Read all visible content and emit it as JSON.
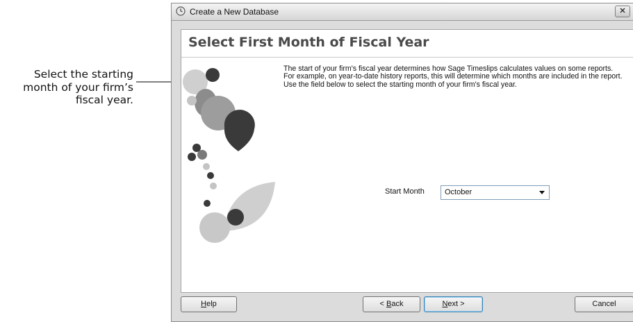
{
  "annotation": {
    "lines": [
      "Select the starting",
      "month of your firm’s",
      "fiscal year."
    ]
  },
  "window": {
    "title": "Create a New Database",
    "close_glyph": "✕"
  },
  "page": {
    "title": "Select First Month of Fiscal Year",
    "description": "The start of your firm's fiscal year determines how Sage Timeslips calculates values on some reports. For example, on year-to-date history reports, this will determine which months are included in the report. Use the field below to select the starting month of your firm's fiscal year.",
    "start_month_label": "Start Month",
    "start_month_value": "October"
  },
  "buttons": {
    "help": {
      "accel": "H",
      "rest": "elp"
    },
    "back": {
      "prefix": "< ",
      "accel": "B",
      "rest": "ack"
    },
    "next": {
      "accel": "N",
      "rest": "ext >"
    },
    "cancel": "Cancel"
  },
  "icons": {
    "title_icon": "clock-icon",
    "dropdown_icon": "chevron-down-icon"
  },
  "colors": {
    "art_dark": "#3a3a3a",
    "art_mid": "#8a8a8a",
    "art_light": "#c4c4c4",
    "next_border": "#3c7fb1"
  }
}
